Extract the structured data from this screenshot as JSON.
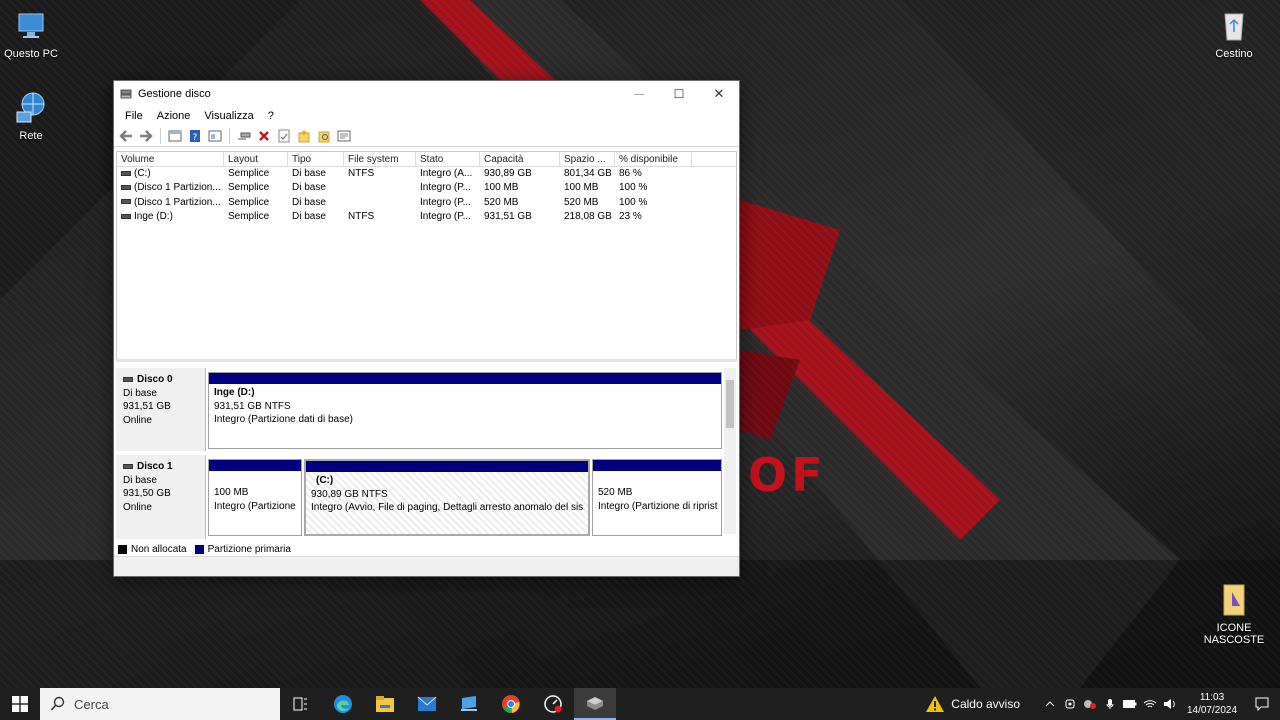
{
  "desktop": {
    "icons": [
      {
        "label": "Questo PC"
      },
      {
        "label": "Rete"
      },
      {
        "label": "Cestino"
      },
      {
        "label_line1": "ICONE",
        "label_line2": "NASCOSTE"
      }
    ],
    "wallpaper_text": "OF"
  },
  "window": {
    "title": "Gestione disco",
    "minimize": "—",
    "maximize": "☐",
    "close": "✕",
    "menu": [
      "File",
      "Azione",
      "Visualizza",
      "?"
    ]
  },
  "volume_list": {
    "columns": [
      "Volume",
      "Layout",
      "Tipo",
      "File system",
      "Stato",
      "Capacità",
      "Spazio ...",
      "% disponibile"
    ],
    "rows": [
      [
        "(C:)",
        "Semplice",
        "Di base",
        "NTFS",
        "Integro (A...",
        "930,89 GB",
        "801,34 GB",
        "86 %"
      ],
      [
        "(Disco 1 Partizion...",
        "Semplice",
        "Di base",
        "",
        "Integro (P...",
        "100 MB",
        "100 MB",
        "100 %"
      ],
      [
        "(Disco 1 Partizion...",
        "Semplice",
        "Di base",
        "",
        "Integro (P...",
        "520 MB",
        "520 MB",
        "100 %"
      ],
      [
        "Inge (D:)",
        "Semplice",
        "Di base",
        "NTFS",
        "Integro (P...",
        "931,51 GB",
        "218,08 GB",
        "23 %"
      ]
    ]
  },
  "disks": [
    {
      "name": "Disco 0",
      "type": "Di base",
      "size": "931,51 GB",
      "status": "Online",
      "partitions": [
        {
          "name": "Inge  (D:)",
          "size": "931,51 GB NTFS",
          "status": "Integro (Partizione dati di base)"
        }
      ]
    },
    {
      "name": "Disco 1",
      "type": "Di base",
      "size": "931,50 GB",
      "status": "Online",
      "partitions": [
        {
          "name": "",
          "size": "100 MB",
          "status": "Integro (Partizione"
        },
        {
          "name": "(C:)",
          "size": "930,89 GB NTFS",
          "status": "Integro (Avvio, File di paging, Dettagli arresto anomalo del sis"
        },
        {
          "name": "",
          "size": "520 MB",
          "status": "Integro (Partizione di riprist"
        }
      ]
    }
  ],
  "legend": [
    {
      "label": "Non allocata",
      "color": "#000000"
    },
    {
      "label": "Partizione primaria",
      "color": "#000080"
    }
  ],
  "taskbar": {
    "search_placeholder": "Cerca",
    "weather": "Caldo avviso",
    "time": "11:03",
    "date": "14/07/2024"
  },
  "colors": {
    "primary_partition": "#000080",
    "accent_red": "#d0101a"
  }
}
